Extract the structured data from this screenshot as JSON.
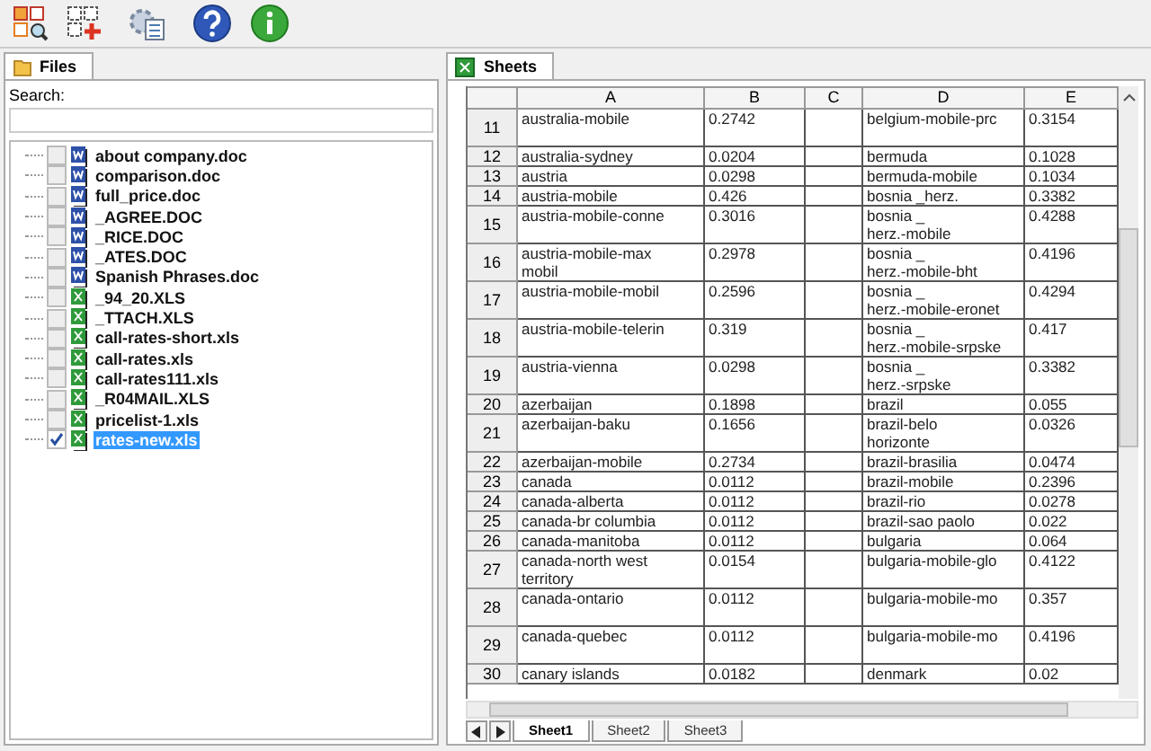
{
  "toolbar": {
    "buttons": [
      {
        "kind": "grid-search"
      },
      {
        "kind": "grid-add"
      },
      {
        "kind": "settings"
      },
      {
        "kind": "help"
      },
      {
        "kind": "info"
      }
    ]
  },
  "files_panel": {
    "tab": "Files",
    "search": {
      "label": "Search:"
    },
    "items": [
      {
        "name": "about company.doc",
        "kind": "doc",
        "checked": false,
        "selected": false
      },
      {
        "name": "comparison.doc",
        "kind": "doc",
        "checked": false,
        "selected": false
      },
      {
        "name": "full_price.doc",
        "kind": "doc",
        "checked": false,
        "selected": false
      },
      {
        "name": "_AGREE.DOC",
        "kind": "doc",
        "checked": false,
        "selected": false
      },
      {
        "name": "_RICE.DOC",
        "kind": "doc",
        "checked": false,
        "selected": false
      },
      {
        "name": "_ATES.DOC",
        "kind": "doc",
        "checked": false,
        "selected": false
      },
      {
        "name": "Spanish Phrases.doc",
        "kind": "doc",
        "checked": false,
        "selected": false
      },
      {
        "name": "_94_20.XLS",
        "kind": "xls",
        "checked": false,
        "selected": false
      },
      {
        "name": "_TTACH.XLS",
        "kind": "xls",
        "checked": false,
        "selected": false
      },
      {
        "name": "call-rates-short.xls",
        "kind": "xls",
        "checked": false,
        "selected": false
      },
      {
        "name": "call-rates.xls",
        "kind": "xls",
        "checked": false,
        "selected": false
      },
      {
        "name": "call-rates111.xls",
        "kind": "xls",
        "checked": false,
        "selected": false
      },
      {
        "name": "_R04MAIL.XLS",
        "kind": "xls",
        "checked": false,
        "selected": false
      },
      {
        "name": "pricelist-1.xls",
        "kind": "xls",
        "checked": false,
        "selected": false
      },
      {
        "name": "rates-new.xls",
        "kind": "xls",
        "checked": true,
        "selected": true
      }
    ]
  },
  "sheets_panel": {
    "tab": "Sheets",
    "columns": [
      "A",
      "B",
      "C",
      "D",
      "E"
    ],
    "rows": [
      {
        "number": "11",
        "tall": true,
        "cells": [
          "australia-mobile",
          "0.2742",
          null,
          "belgium-mobile-prc",
          "0.3154"
        ]
      },
      {
        "number": "12",
        "tall": false,
        "cells": [
          "australia-sydney",
          "0.0204",
          null,
          "bermuda",
          "0.1028"
        ]
      },
      {
        "number": "13",
        "tall": false,
        "cells": [
          "austria",
          "0.0298",
          null,
          "bermuda-mobile",
          "0.1034"
        ]
      },
      {
        "number": "14",
        "tall": false,
        "cells": [
          "austria-mobile",
          "0.426",
          null,
          "bosnia _herz.",
          "0.3382"
        ]
      },
      {
        "number": "15",
        "tall": true,
        "cells": [
          "austria-mobile-conne",
          "0.3016",
          null,
          "bosnia _\nherz.-mobile",
          "0.4288"
        ]
      },
      {
        "number": "16",
        "tall": true,
        "cells": [
          "austria-mobile-max\nmobil",
          "0.2978",
          null,
          "bosnia _\nherz.-mobile-bht",
          "0.4196"
        ]
      },
      {
        "number": "17",
        "tall": true,
        "cells": [
          "austria-mobile-mobil",
          "0.2596",
          null,
          "bosnia _\nherz.-mobile-eronet",
          "0.4294"
        ]
      },
      {
        "number": "18",
        "tall": true,
        "cells": [
          "austria-mobile-telerin",
          "0.319",
          null,
          "bosnia _\nherz.-mobile-srpske",
          "0.417"
        ]
      },
      {
        "number": "19",
        "tall": true,
        "cells": [
          "austria-vienna",
          "0.0298",
          null,
          "bosnia _\nherz.-srpske",
          "0.3382"
        ]
      },
      {
        "number": "20",
        "tall": false,
        "cells": [
          "azerbaijan",
          "0.1898",
          null,
          "brazil",
          "0.055"
        ]
      },
      {
        "number": "21",
        "tall": true,
        "cells": [
          "azerbaijan-baku",
          "0.1656",
          null,
          "brazil-belo\nhorizonte",
          "0.0326"
        ]
      },
      {
        "number": "22",
        "tall": false,
        "cells": [
          "azerbaijan-mobile",
          "0.2734",
          null,
          "brazil-brasilia",
          "0.0474"
        ]
      },
      {
        "number": "23",
        "tall": false,
        "cells": [
          "canada",
          "0.0112",
          null,
          "brazil-mobile",
          "0.2396"
        ]
      },
      {
        "number": "24",
        "tall": false,
        "cells": [
          "canada-alberta",
          "0.0112",
          null,
          "brazil-rio",
          "0.0278"
        ]
      },
      {
        "number": "25",
        "tall": false,
        "cells": [
          "canada-br columbia",
          "0.0112",
          null,
          "brazil-sao paolo",
          "0.022"
        ]
      },
      {
        "number": "26",
        "tall": false,
        "cells": [
          "canada-manitoba",
          "0.0112",
          null,
          "bulgaria",
          "0.064"
        ]
      },
      {
        "number": "27",
        "tall": true,
        "cells": [
          "canada-north west\nterritory",
          "0.0154",
          null,
          "bulgaria-mobile-glo",
          "0.4122"
        ]
      },
      {
        "number": "28",
        "tall": true,
        "cells": [
          "canada-ontario",
          "0.0112",
          null,
          "bulgaria-mobile-mo",
          "0.357"
        ]
      },
      {
        "number": "29",
        "tall": true,
        "cells": [
          "canada-quebec",
          "0.0112",
          null,
          "bulgaria-mobile-mo",
          "0.4196"
        ]
      },
      {
        "number": "30",
        "tall": false,
        "cells": [
          "canary islands",
          "0.0182",
          null,
          "denmark",
          "0.02"
        ]
      }
    ],
    "sheet_tabs": [
      {
        "label": "Sheet1",
        "selected": true
      },
      {
        "label": "Sheet2",
        "selected": false
      },
      {
        "label": "Sheet3",
        "selected": false
      }
    ]
  }
}
